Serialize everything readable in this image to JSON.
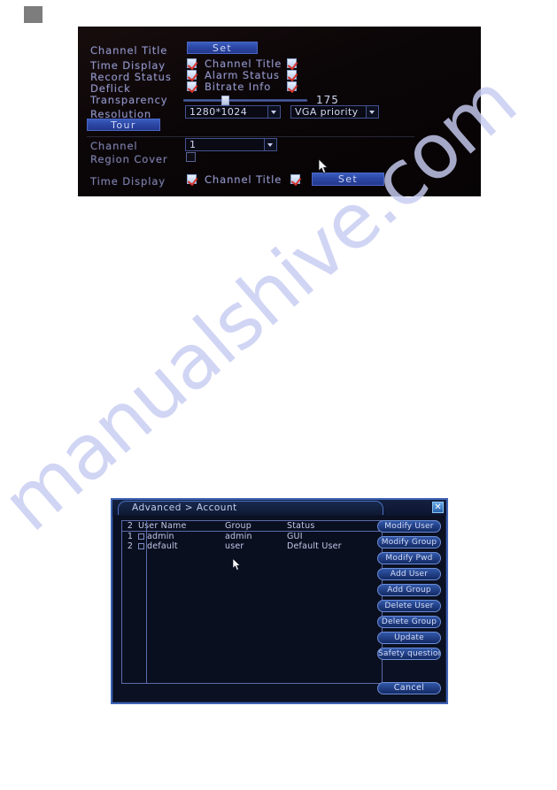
{
  "watermark": {
    "text": "manualshive.com"
  },
  "figure_display": {
    "rows": {
      "channel_title_label": "Channel Title",
      "channel_title_set_button": "Set",
      "time_display_label": "Time Display",
      "channel_title_cb_label": "Channel Title",
      "record_status_label": "Record Status",
      "alarm_status_label": "Alarm Status",
      "deflick_label": "Deflick",
      "bitrate_info_label": "Bitrate Info",
      "transparency_label": "Transparency",
      "transparency_value": "175",
      "resolution_label": "Resolution",
      "resolution_value": "1280*1024",
      "output_priority_value": "VGA priority",
      "tour_button": "Tour",
      "channel_label": "Channel",
      "channel_value": "1",
      "region_cover_label": "Region Cover",
      "bottom_time_display_label": "Time Display",
      "bottom_channel_title_label": "Channel Title",
      "bottom_set_button": "Set"
    },
    "checkbox_states": {
      "time_display": true,
      "channel_title_top": true,
      "record_status": true,
      "alarm_status": true,
      "deflick": true,
      "bitrate_info": true,
      "region_cover": false,
      "bottom_time_display": true,
      "bottom_channel_title": true
    },
    "colors": {
      "panel_background": "#0a0607",
      "label_text": "#8f93c4",
      "button_blue": "#2c47a5",
      "check_red": "#d8342b"
    }
  },
  "figure_account": {
    "title": "Advanced > Account",
    "close_label": "✕",
    "table": {
      "headers": [
        "2",
        "User Name",
        "Group",
        "Status"
      ],
      "rows": [
        {
          "index": "1",
          "user_name": "admin",
          "group": "admin",
          "status": "GUI"
        },
        {
          "index": "2",
          "user_name": "default",
          "group": "user",
          "status": "Default User"
        }
      ]
    },
    "buttons": [
      "Modify User",
      "Modify Group",
      "Modify Pwd",
      "Add User",
      "Add Group",
      "Delete User",
      "Delete Group",
      "Update",
      "Safety question"
    ],
    "cancel_button": "Cancel",
    "colors": {
      "dialog_background": "#0b1022",
      "border_blue": "#3f63b4",
      "button_blue": "#24428a",
      "text": "#c2c9e8"
    }
  }
}
